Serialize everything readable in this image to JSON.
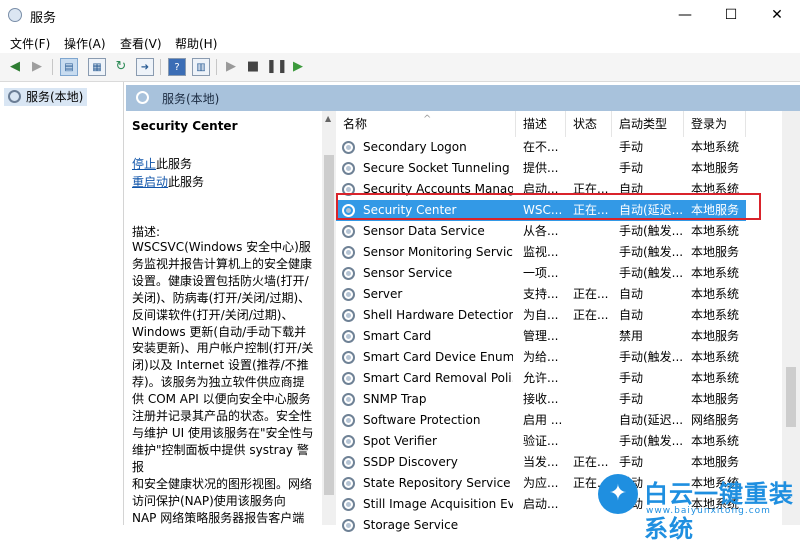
{
  "window": {
    "title": "服务",
    "minimize_glyph": "—",
    "maximize_glyph": "☐",
    "close_glyph": "✕"
  },
  "menu": [
    "文件(F)",
    "操作(A)",
    "查看(V)",
    "帮助(H)"
  ],
  "toolbar_icons": [
    "back-arrow-icon",
    "forward-arrow-icon",
    "console-tree-icon",
    "properties-icon",
    "refresh-icon",
    "export-list-icon",
    "help-icon",
    "action-pane-icon",
    "start-service-icon",
    "stop-service-icon",
    "pause-service-icon",
    "resume-service-icon"
  ],
  "tree": {
    "item": "服务(本地)"
  },
  "header": {
    "title": "服务(本地)"
  },
  "description": {
    "service_name": "Security Center",
    "stop_link": "停止",
    "stop_suffix": "此服务",
    "restart_link": "重启动",
    "restart_suffix": "此服务",
    "label": "描述:",
    "text": "WSCSVC(Windows 安全中心)服\n务监视并报告计算机上的安全健康\n设置。健康设置包括防火墙(打开/\n关闭)、防病毒(打开/关闭/过期)、\n反间谍软件(打开/关闭/过期)、\nWindows 更新(自动/手动下载并\n安装更新)、用户帐户控制(打开/关\n闭)以及 Internet 设置(推荐/不推\n荐)。该服务为独立软件供应商提\n供 COM API 以便向安全中心服务\n注册并记录其产品的状态。安全性\n与维护 UI 使用该服务在\"安全性与\n维护\"控制面板中提供 systray 警报\n和安全健康状况的图形视图。网络\n访问保护(NAP)使用该服务向\nNAP 网络策略服务器报告客户端的\n安全健康状况，以便进行网络隔离"
  },
  "columns": {
    "name": "名称",
    "desc": "描述",
    "status": "状态",
    "startup": "启动类型",
    "logon": "登录为"
  },
  "services": [
    {
      "name": "Secondary Logon",
      "desc": "在不...",
      "status": "",
      "startup": "手动",
      "logon": "本地系统"
    },
    {
      "name": "Secure Socket Tunneling ...",
      "desc": "提供...",
      "status": "",
      "startup": "手动",
      "logon": "本地服务"
    },
    {
      "name": "Security Accounts Manag...",
      "desc": "启动...",
      "status": "正在...",
      "startup": "自动",
      "logon": "本地系统"
    },
    {
      "name": "Security Center",
      "desc": "WSC...",
      "status": "正在...",
      "startup": "自动(延迟...",
      "logon": "本地服务"
    },
    {
      "name": "Sensor Data Service",
      "desc": "从各...",
      "status": "",
      "startup": "手动(触发...",
      "logon": "本地系统"
    },
    {
      "name": "Sensor Monitoring Service",
      "desc": "监视...",
      "status": "",
      "startup": "手动(触发...",
      "logon": "本地服务"
    },
    {
      "name": "Sensor Service",
      "desc": "一项...",
      "status": "",
      "startup": "手动(触发...",
      "logon": "本地系统"
    },
    {
      "name": "Server",
      "desc": "支持...",
      "status": "正在...",
      "startup": "自动",
      "logon": "本地系统"
    },
    {
      "name": "Shell Hardware Detection",
      "desc": "为自...",
      "status": "正在...",
      "startup": "自动",
      "logon": "本地系统"
    },
    {
      "name": "Smart Card",
      "desc": "管理...",
      "status": "",
      "startup": "禁用",
      "logon": "本地服务"
    },
    {
      "name": "Smart Card Device Enum...",
      "desc": "为给...",
      "status": "",
      "startup": "手动(触发...",
      "logon": "本地系统"
    },
    {
      "name": "Smart Card Removal Poli...",
      "desc": "允许...",
      "status": "",
      "startup": "手动",
      "logon": "本地系统"
    },
    {
      "name": "SNMP Trap",
      "desc": "接收...",
      "status": "",
      "startup": "手动",
      "logon": "本地服务"
    },
    {
      "name": "Software Protection",
      "desc": "启用 ...",
      "status": "",
      "startup": "自动(延迟...",
      "logon": "网络服务"
    },
    {
      "name": "Spot Verifier",
      "desc": "验证...",
      "status": "",
      "startup": "手动(触发...",
      "logon": "本地系统"
    },
    {
      "name": "SSDP Discovery",
      "desc": "当发...",
      "status": "正在...",
      "startup": "手动",
      "logon": "本地服务"
    },
    {
      "name": "State Repository Service",
      "desc": "为应...",
      "status": "正在...",
      "startup": "手动",
      "logon": "本地系统"
    },
    {
      "name": "Still Image Acquisition Ev...",
      "desc": "启动...",
      "status": "",
      "startup": "手动",
      "logon": "本地系统"
    },
    {
      "name": "Storage Service",
      "desc": "",
      "status": "",
      "startup": "",
      "logon": ""
    }
  ],
  "selected_index": 3,
  "colors": {
    "selection": "#3399e6",
    "header_band": "#a8c2dc",
    "highlight_border": "#d9232b",
    "watermark": "#1f8fe0"
  },
  "watermark": {
    "text": "白云一键重装系统",
    "url": "www.baiyunxitong.com"
  }
}
